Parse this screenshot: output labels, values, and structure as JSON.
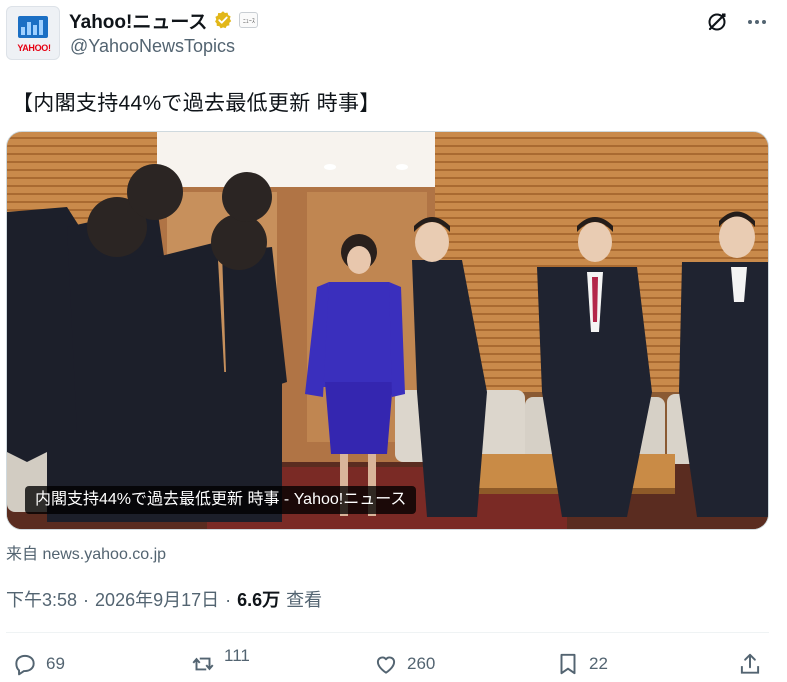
{
  "account": {
    "display_name": "Yahoo!ニュース",
    "handle": "@YahooNewsTopics",
    "avatar_text": "YAHOO!",
    "affiliation_badge": "ﾆｭｰｽ",
    "verified_color": "#e2b719"
  },
  "tweet": {
    "text": "【内閣支持44%で過去最低更新 時事】"
  },
  "card": {
    "caption": "内閣支持44%で過去最低更新 時事 - Yahoo!ニュース",
    "source": "来自 news.yahoo.co.jp"
  },
  "meta": {
    "time": "下午3:58",
    "date": "2026年9月17日",
    "views_count": "6.6万",
    "views_label": "查看"
  },
  "actions": {
    "replies": "69",
    "retweets": "111",
    "likes": "260",
    "bookmarks": "22"
  },
  "colors": {
    "text_secondary": "#536471",
    "accent": "#1d9bf0"
  },
  "icons": [
    "grok-icon",
    "more-icon",
    "reply-icon",
    "retweet-icon",
    "like-icon",
    "bookmark-icon",
    "share-icon"
  ]
}
